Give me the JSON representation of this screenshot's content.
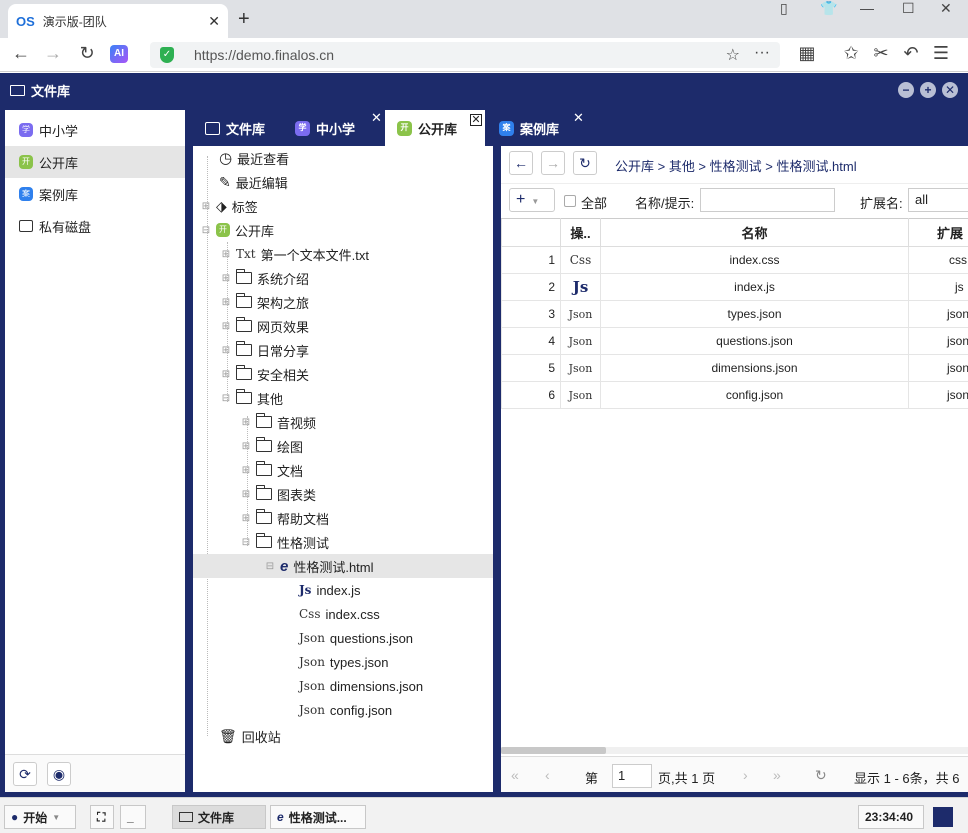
{
  "browser": {
    "tab_logo": "OS",
    "tab_title": "演示版-团队",
    "tab_close": "✕",
    "new_tab": "+",
    "url": "https://demo.finalos.cn",
    "ai_label": "AI"
  },
  "app": {
    "title": "文件库",
    "controls": [
      "−",
      "+",
      "✕"
    ]
  },
  "leftnav": {
    "items": [
      {
        "label": "中小学",
        "icon_text": "学",
        "color": "#7b6cf0"
      },
      {
        "label": "公开库",
        "icon_text": "开",
        "color": "#8bc34a"
      },
      {
        "label": "案例库",
        "icon_text": "案",
        "color": "#2f80ed"
      },
      {
        "label": "私有磁盘",
        "icon_text": "",
        "color": "#333333"
      }
    ],
    "active_index": 1
  },
  "content_tabs": [
    {
      "label": "文件库"
    },
    {
      "label": "中小学"
    },
    {
      "label": "公开库"
    },
    {
      "label": "案例库"
    }
  ],
  "tree": {
    "recent_view": "最近查看",
    "recent_edit": "最近编辑",
    "tags": "标签",
    "public": "公开库",
    "txt_file": "第一个文本文件.txt",
    "folders": [
      "系统介绍",
      "架构之旅",
      "网页效果",
      "日常分享",
      "安全相关",
      "其他"
    ],
    "sub_folders": [
      "音视频",
      "绘图",
      "文档",
      "图表类",
      "帮助文档",
      "性格测试"
    ],
    "html_file": "性格测试.html",
    "files": [
      {
        "ext": "Js",
        "name": "index.js"
      },
      {
        "ext": "Css",
        "name": "index.css"
      },
      {
        "ext": "Json",
        "name": "questions.json"
      },
      {
        "ext": "Json",
        "name": "types.json"
      },
      {
        "ext": "Json",
        "name": "dimensions.json"
      },
      {
        "ext": "Json",
        "name": "config.json"
      }
    ],
    "recycle": "回收站",
    "txt_ext": "Txt"
  },
  "breadcrumb": "公开库 > 其他 > 性格测试 > 性格测试.html",
  "toolbar": {
    "add": "+",
    "select_all": "全部",
    "name_hint_label": "名称/提示:",
    "ext_label": "扩展名:",
    "ext_value": "all"
  },
  "grid": {
    "headers": [
      "",
      "操..",
      "名称",
      "扩展"
    ],
    "rows": [
      {
        "num": "1",
        "ext": "Css",
        "name": "index.css",
        "type": "css"
      },
      {
        "num": "2",
        "ext": "Js",
        "name": "index.js",
        "type": "js"
      },
      {
        "num": "3",
        "ext": "Json",
        "name": "types.json",
        "type": "json"
      },
      {
        "num": "4",
        "ext": "Json",
        "name": "questions.json",
        "type": "json"
      },
      {
        "num": "5",
        "ext": "Json",
        "name": "dimensions.json",
        "type": "json"
      },
      {
        "num": "6",
        "ext": "Json",
        "name": "config.json",
        "type": "json"
      }
    ]
  },
  "pager": {
    "page_prefix": "第",
    "page_value": "1",
    "page_suffix": "页,共 1 页",
    "display": "显示 1 - 6条，共 6"
  },
  "taskbar": {
    "start": "开始",
    "windows": [
      "文件库",
      "性格测试..."
    ],
    "clock": "23:34:40"
  }
}
